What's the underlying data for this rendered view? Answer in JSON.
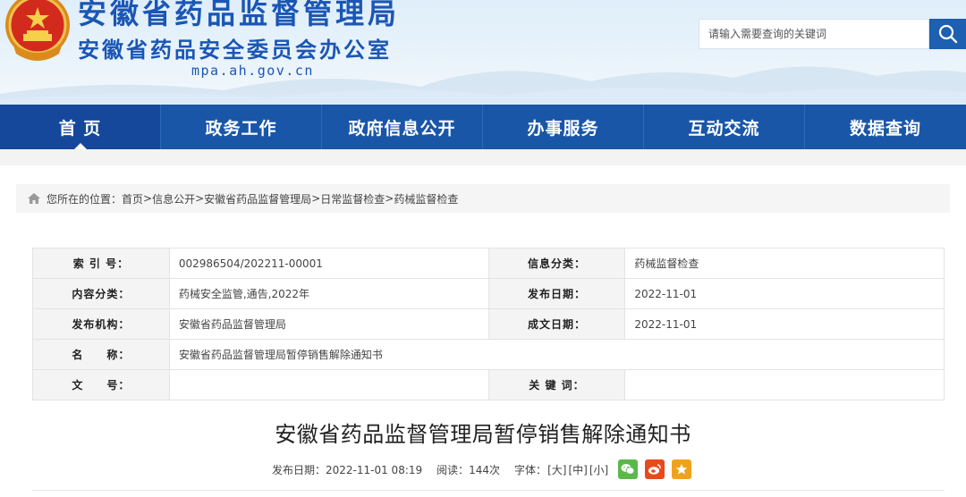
{
  "header": {
    "org_name": "安徽省药品监督管理局",
    "org_sub": "安徽省药品安全委员会办公室",
    "domain": "mpa.ah.gov.cn",
    "search_placeholder": "请输入需要查询的关键词"
  },
  "nav": {
    "items": [
      {
        "label": "首 页"
      },
      {
        "label": "政务工作"
      },
      {
        "label": "政府信息公开"
      },
      {
        "label": "办事服务"
      },
      {
        "label": "互动交流"
      },
      {
        "label": "数据查询"
      }
    ]
  },
  "breadcrumb": {
    "prefix": "您所在的位置：",
    "items": [
      "首页",
      "信息公开",
      "安徽省药品监督管理局",
      "日常监督检查",
      "药械监督检查"
    ],
    "separator": " > "
  },
  "meta": {
    "index_label": "索 引 号：",
    "index_value": "002986504/202211-00001",
    "info_cat_label": "信息分类：",
    "info_cat_value": "药械监督检查",
    "content_cat_label": "内容分类：",
    "content_cat_value": "药械安全监管,通告,2022年",
    "publish_date_label": "发布日期：",
    "publish_date_value": "2022-11-01",
    "publisher_label": "发布机构：",
    "publisher_value": "安徽省药品监督管理局",
    "doc_date_label": "成文日期：",
    "doc_date_value": "2022-11-01",
    "name_label": "名　　称：",
    "name_value": "安徽省药品监督管理局暂停销售解除通知书",
    "doc_no_label": "文　　号：",
    "doc_no_value": "",
    "keywords_label": "关 键 词：",
    "keywords_value": ""
  },
  "article": {
    "title": "安徽省药品监督管理局暂停销售解除通知书",
    "publish_info": "发布日期：2022-11-01 08:19",
    "reads": "阅读：144次",
    "font_label": "字体：",
    "font_large": "[大]",
    "font_medium": "[中]",
    "font_small": "[小]"
  },
  "icons": {
    "home": "home-icon",
    "search": "search-icon",
    "wechat": "wechat-icon",
    "weibo": "weibo-icon",
    "favorite": "star-icon"
  },
  "colors": {
    "brand_blue": "#1a56a8",
    "title_blue": "#1a56b5",
    "wechat_green": "#5bb84b",
    "weibo_red": "#e84a1c",
    "fav_orange": "#f0a21c"
  }
}
